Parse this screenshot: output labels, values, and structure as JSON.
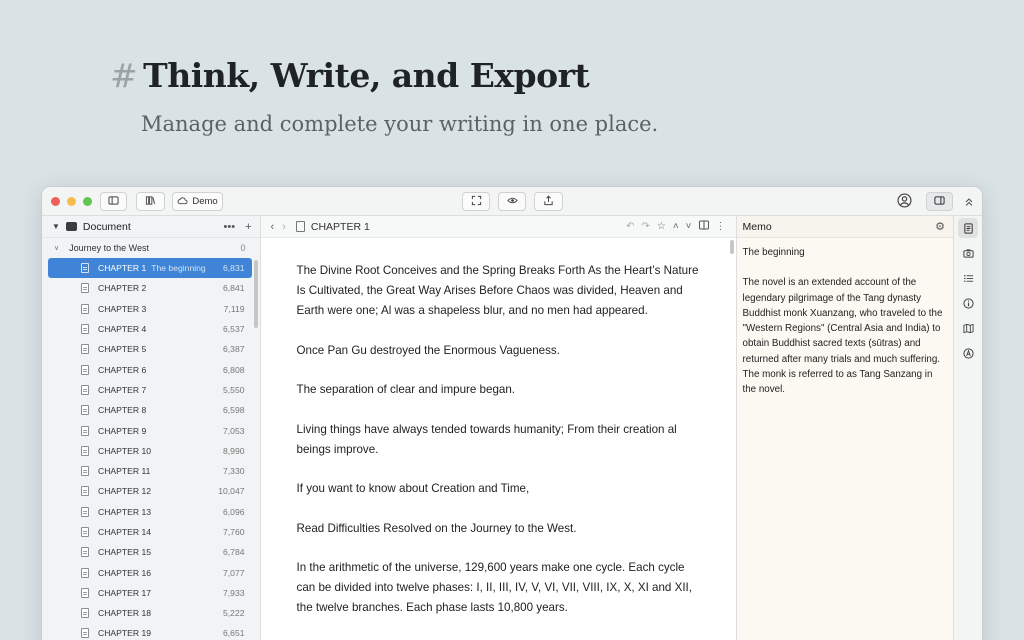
{
  "hero": {
    "hash": "#",
    "title": "Think, Write, and Export",
    "subtitle": "Manage and complete your writing in one place."
  },
  "titlebar": {
    "traffic_colors": [
      "#ee5f57",
      "#f5bd4f",
      "#61c554"
    ],
    "cloud_label": "Demo",
    "icons": [
      "sidebar-toggle-icon",
      "library-icon",
      "cloud-icon",
      "fullscreen-icon",
      "preview-eye-icon",
      "export-share-icon",
      "account-icon",
      "panel-toggle-icon",
      "collapse-up-icon"
    ]
  },
  "sidebar": {
    "header": "Document",
    "actions": [
      "•••",
      "+"
    ],
    "book": {
      "title": "Journey to the West",
      "count": "0"
    },
    "chapters": [
      {
        "title": "CHAPTER 1",
        "subtitle": "The beginning",
        "count": "6,831",
        "active": true
      },
      {
        "title": "CHAPTER 2",
        "subtitle": "",
        "count": "6,841"
      },
      {
        "title": "CHAPTER 3",
        "subtitle": "",
        "count": "7,119"
      },
      {
        "title": "CHAPTER 4",
        "subtitle": "",
        "count": "6,537"
      },
      {
        "title": "CHAPTER 5",
        "subtitle": "",
        "count": "6,387"
      },
      {
        "title": "CHAPTER 6",
        "subtitle": "",
        "count": "6,808"
      },
      {
        "title": "CHAPTER 7",
        "subtitle": "",
        "count": "5,550"
      },
      {
        "title": "CHAPTER 8",
        "subtitle": "",
        "count": "6,598"
      },
      {
        "title": "CHAPTER 9",
        "subtitle": "",
        "count": "7,053"
      },
      {
        "title": "CHAPTER 10",
        "subtitle": "",
        "count": "8,990"
      },
      {
        "title": "CHAPTER 11",
        "subtitle": "",
        "count": "7,330"
      },
      {
        "title": "CHAPTER 12",
        "subtitle": "",
        "count": "10,047"
      },
      {
        "title": "CHAPTER 13",
        "subtitle": "",
        "count": "6,096"
      },
      {
        "title": "CHAPTER 14",
        "subtitle": "",
        "count": "7,760"
      },
      {
        "title": "CHAPTER 15",
        "subtitle": "",
        "count": "6,784"
      },
      {
        "title": "CHAPTER 16",
        "subtitle": "",
        "count": "7,077"
      },
      {
        "title": "CHAPTER 17",
        "subtitle": "",
        "count": "7,933"
      },
      {
        "title": "CHAPTER 18",
        "subtitle": "",
        "count": "5,222"
      },
      {
        "title": "CHAPTER 19",
        "subtitle": "",
        "count": "6,651"
      }
    ]
  },
  "editor": {
    "title": "CHAPTER 1",
    "paragraphs": [
      "The Divine Root Conceives and the Spring Breaks Forth As the Heart’s Nature Is Cultivated, the Great Way Arises Before Chaos was divided, Heaven and Earth were one; Al was a shapeless blur, and no men had appeared.",
      "Once Pan Gu destroyed the Enormous Vagueness.",
      "The separation of clear and impure began.",
      "Living things have always tended towards humanity; From their creation al beings improve.",
      "If you want to know about Creation and Time,",
      "Read Difficulties Resolved on the Journey to the West.",
      "In the arithmetic of the universe, 129,600 years make one cycle. Each cycle can be divided into twelve phases: I, II, III, IV, V, VI, VII, VIII, IX, X, XI and XII, the twelve branches. Each phase lasts 10,800 years."
    ]
  },
  "memo": {
    "header": "Memo",
    "title": "The beginning",
    "body": "The novel is an extended account of the legendary pilgrimage of the Tang dynasty Buddhist monk Xuanzang, who traveled to the \"Western Regions\" (Central Asia and India) to obtain Buddhist sacred texts (sūtras) and returned after many trials and much suffering. The monk is referred to as Tang Sanzang in the novel."
  },
  "rail": {
    "icons": [
      "memo-icon",
      "snapshot-camera-icon",
      "outline-list-icon",
      "info-icon",
      "map-icon",
      "character-icon"
    ]
  }
}
